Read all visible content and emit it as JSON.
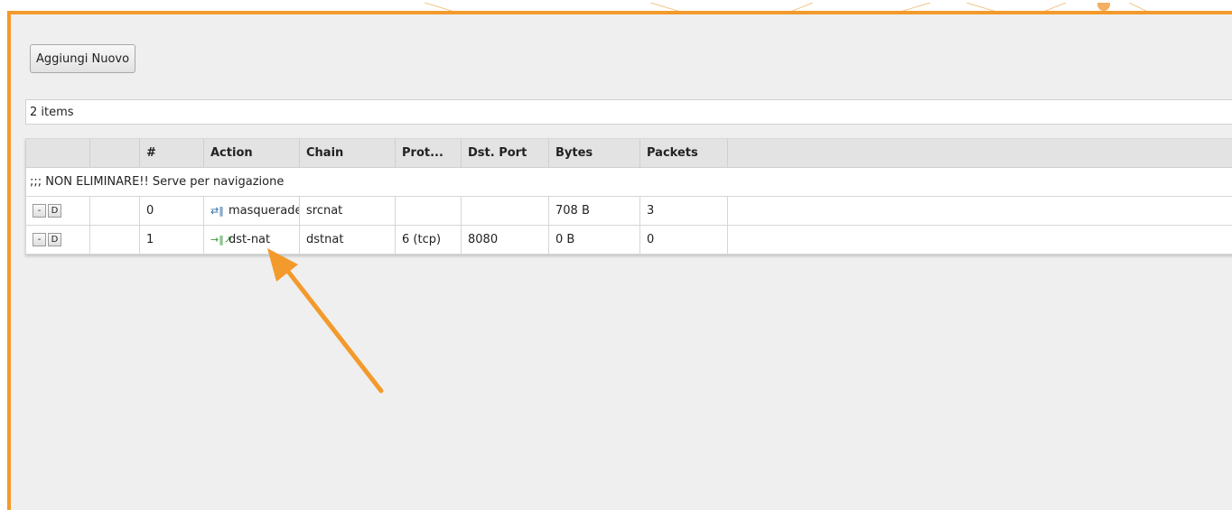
{
  "toolbar": {
    "add_new_label": "Aggiungi Nuovo"
  },
  "list": {
    "items_count": "2 items"
  },
  "table": {
    "headers": {
      "num": "#",
      "action": "Action",
      "chain": "Chain",
      "protocol": "Prot...",
      "dst_port": "Dst. Port",
      "bytes": "Bytes",
      "packets": "Packets"
    },
    "comment": ";;; NON ELIMINARE!! Serve per navigazione",
    "row_button_remove": "-",
    "row_button_disable": "D",
    "rows": [
      {
        "num": "0",
        "action_icon": "masquerade-icon",
        "action": "masquerade",
        "chain": "srcnat",
        "protocol": "",
        "dst_port": "",
        "bytes": "708 B",
        "packets": "3"
      },
      {
        "num": "1",
        "action_icon": "dst-nat-icon",
        "action": "dst-nat",
        "chain": "dstnat",
        "protocol": "6 (tcp)",
        "dst_port": "8080",
        "bytes": "0 B",
        "packets": "0"
      }
    ]
  },
  "colors": {
    "frame_accent": "#f39a2c",
    "annotation_arrow": "#f39a2c"
  },
  "annotation": {
    "arrow_icon": "annotation-arrow"
  }
}
